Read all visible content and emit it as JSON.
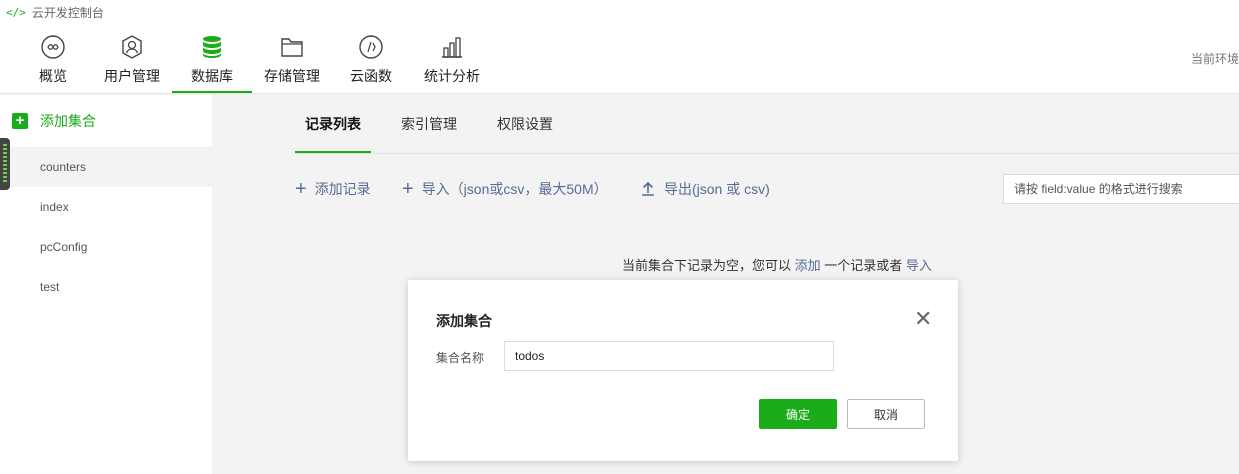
{
  "window": {
    "title": "云开发控制台",
    "icon": "code-icon"
  },
  "nav": {
    "items": [
      {
        "label": "概览",
        "icon": "overview-icon"
      },
      {
        "label": "用户管理",
        "icon": "user-icon"
      },
      {
        "label": "数据库",
        "icon": "database-icon",
        "active": true
      },
      {
        "label": "存储管理",
        "icon": "folder-icon"
      },
      {
        "label": "云函数",
        "icon": "function-icon"
      },
      {
        "label": "统计分析",
        "icon": "chart-icon"
      }
    ],
    "env_label": "当前环境"
  },
  "sidebar": {
    "add_label": "添加集合",
    "collections": [
      "counters",
      "index",
      "pcConfig",
      "test"
    ],
    "active_collection": "counters"
  },
  "main": {
    "tabs": [
      "记录列表",
      "索引管理",
      "权限设置"
    ],
    "active_tab": "记录列表",
    "toolbar": {
      "add_record": "添加记录",
      "import": "导入（json或csv，最大50M）",
      "export": "导出(json 或 csv)"
    },
    "search_placeholder": "请按 field:value 的格式进行搜索",
    "empty": {
      "prefix": "当前集合下记录为空，您可以",
      "add_link": "添加",
      "middle": "一个记录或者",
      "import_link": "导入"
    }
  },
  "dialog": {
    "title": "添加集合",
    "field_label": "集合名称",
    "field_value": "todos",
    "ok_label": "确定",
    "cancel_label": "取消"
  },
  "colors": {
    "accent": "#1aad19",
    "link": "#576b95"
  }
}
